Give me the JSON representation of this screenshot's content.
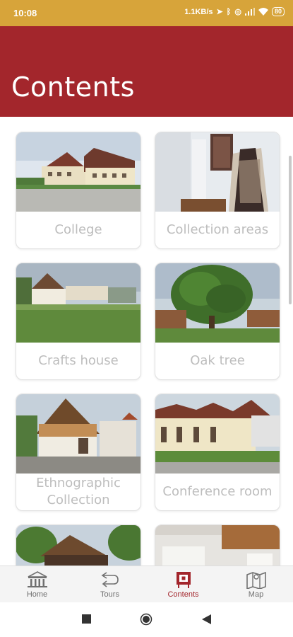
{
  "status_bar": {
    "time": "10:08",
    "network_speed": "1.1KB/s",
    "battery": "80"
  },
  "header": {
    "title": "Contents"
  },
  "cards": [
    {
      "label": "College",
      "image": "college-building-photo"
    },
    {
      "label": "Collection areas",
      "image": "costume-exhibit-photo"
    },
    {
      "label": "Crafts house",
      "image": "crafts-house-photo"
    },
    {
      "label": "Oak tree",
      "image": "oak-tree-photo"
    },
    {
      "label": "Ethnographic Collection",
      "image": "ethnographic-building-photo"
    },
    {
      "label": "Conference room",
      "image": "conference-building-photo"
    },
    {
      "label": "",
      "image": "pavilion-photo"
    },
    {
      "label": "",
      "image": "interior-hall-photo"
    }
  ],
  "bottom_nav": [
    {
      "label": "Home",
      "icon": "museum-icon",
      "active": false
    },
    {
      "label": "Tours",
      "icon": "route-icon",
      "active": false
    },
    {
      "label": "Contents",
      "icon": "exhibit-frame-icon",
      "active": true
    },
    {
      "label": "Map",
      "icon": "map-icon",
      "active": false
    }
  ],
  "colors": {
    "accent": "#a3262c",
    "status_bar": "#d7a43a",
    "label_text": "#bdbdbd"
  }
}
